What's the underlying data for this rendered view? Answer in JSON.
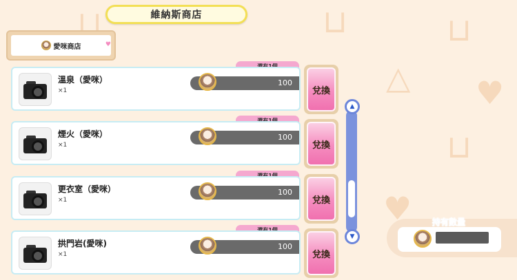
{
  "shop_title": "維納斯商店",
  "shop_tab": {
    "label": "愛咪商店"
  },
  "exchange_label": "兌換",
  "items": [
    {
      "name": "溫泉（愛咪）",
      "qty": "×1",
      "price": "100",
      "remaining": "還有1個"
    },
    {
      "name": "煙火（愛咪）",
      "qty": "×1",
      "price": "100",
      "remaining": "還有1個"
    },
    {
      "name": "更衣室（愛咪）",
      "qty": "×1",
      "price": "100",
      "remaining": "還有1個"
    },
    {
      "name": "拱門岩(愛咪)",
      "qty": "×1",
      "price": "100",
      "remaining": "還有1個"
    }
  ],
  "held": {
    "title": "持有數量",
    "value": ""
  },
  "icons": {
    "currency": "venus-coin-icon",
    "item": "camera-icon",
    "scroll_up": "triangle-up-icon",
    "scroll_down": "triangle-down-icon",
    "decor": "heart-icon"
  },
  "colors": {
    "background": "#fdf0e1",
    "exchange_button": "#f58cbf",
    "remaining_tag": "#f5a8cf",
    "scrollbar": "#7b92dd",
    "held_title": "#2e6fd0"
  }
}
